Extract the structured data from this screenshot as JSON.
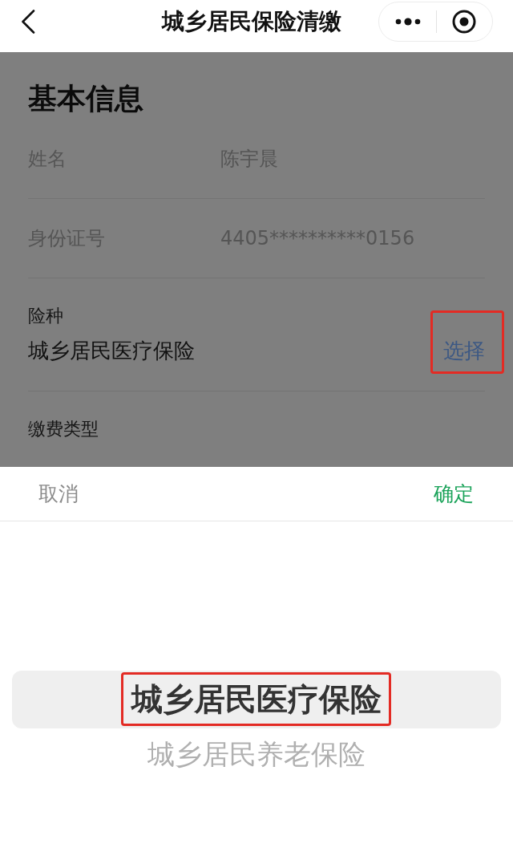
{
  "nav_bar": {
    "title": "城乡居民保险清缴"
  },
  "form": {
    "heading": "基本信息",
    "fields": [
      {
        "kind": "inline",
        "label": "姓名",
        "value": "陈宇晨"
      },
      {
        "kind": "inline",
        "label": "身份证号",
        "value": "4405**********0156"
      },
      {
        "kind": "select",
        "label": "险种",
        "value": "城乡居民医疗保险",
        "action": "选择",
        "highlighted": true
      },
      {
        "kind": "select",
        "label": "缴费类型",
        "highlighted": false
      }
    ]
  },
  "picker": {
    "cancel": "取消",
    "confirm": "确定",
    "options": [
      {
        "label": "城乡居民医疗保险",
        "selected": true,
        "highlighted": true
      },
      {
        "label": "城乡居民养老保险",
        "selected": false,
        "highlighted": false
      }
    ]
  }
}
